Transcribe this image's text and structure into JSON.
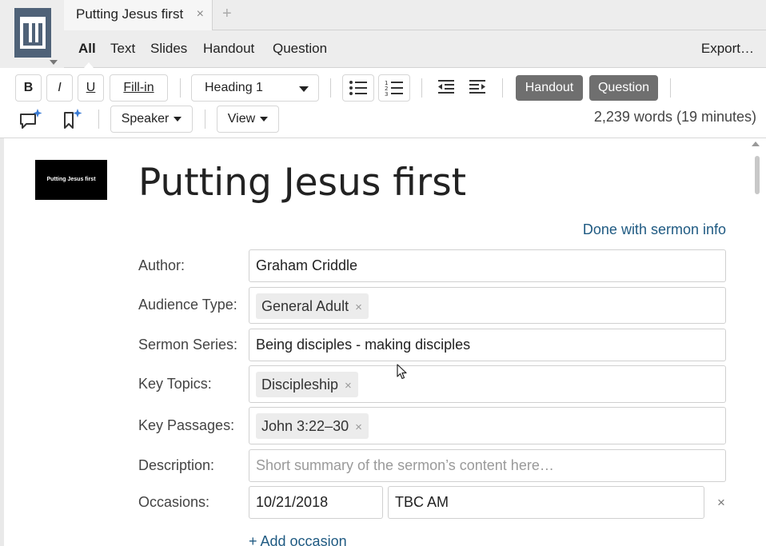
{
  "tabs": {
    "document_tab": "Putting Jesus first",
    "close_glyph": "×",
    "new_tab_glyph": "+"
  },
  "modes": [
    "All",
    "Text",
    "Slides",
    "Handout",
    "Question"
  ],
  "export_label": "Export…",
  "toolbar": {
    "bold": "B",
    "italic": "I",
    "underline": "U",
    "fillin": "Fill-in",
    "style_select": "Heading 1",
    "handout": "Handout",
    "question": "Question",
    "speaker": "Speaker",
    "view": "View",
    "word_count": "2,239 words (19 minutes)"
  },
  "document": {
    "thumbnail_text": "Putting Jesus first",
    "title": "Putting Jesus first",
    "done_link": "Done with sermon info",
    "author_label": "Author:",
    "author_value": "Graham Criddle",
    "audience_label": "Audience Type:",
    "audience_tag": "General Adult",
    "series_label": "Sermon Series:",
    "series_value": "Being disciples - making disciples",
    "topics_label": "Key Topics:",
    "topics_tag": "Discipleship",
    "passages_label": "Key Passages:",
    "passages_tag": "John 3:22–30",
    "description_label": "Description:",
    "description_placeholder": "Short summary of the sermon’s content here…",
    "occasions_label": "Occasions:",
    "occasion_date": "10/21/2018",
    "occasion_name": "TBC AM",
    "add_occasion": "+ Add occasion",
    "tag_remove_glyph": "×"
  },
  "colors": {
    "logo": "#4f6278",
    "pill": "#6f6f6f",
    "link": "#1f5a82"
  }
}
